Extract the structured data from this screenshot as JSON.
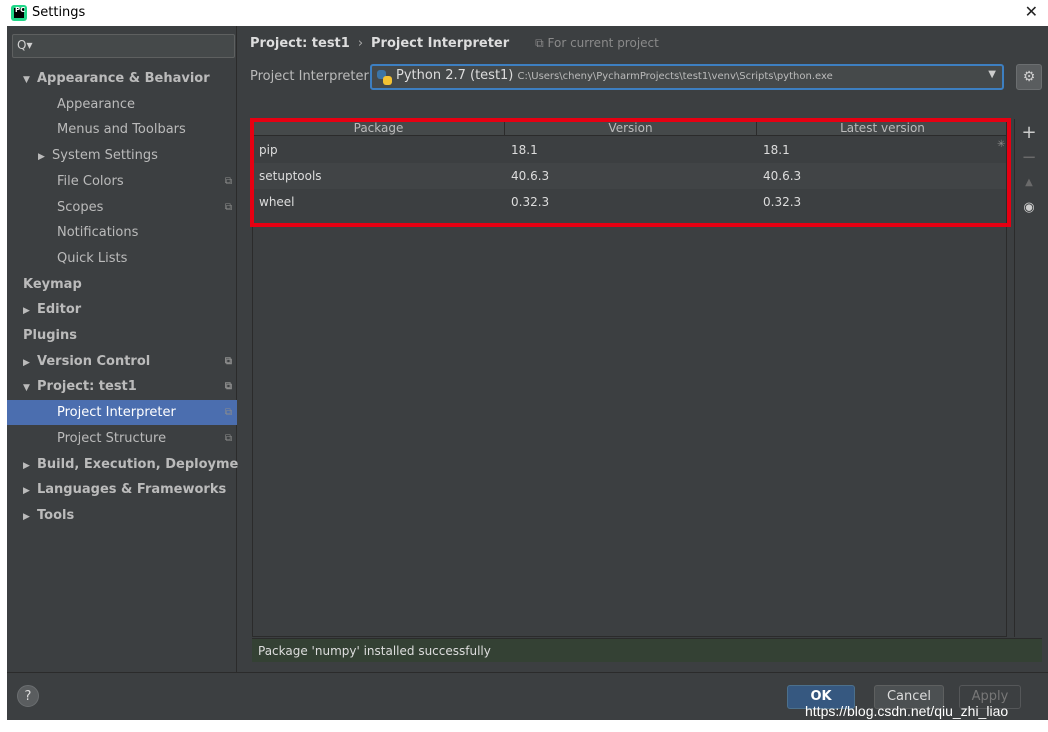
{
  "window": {
    "title": "Settings",
    "close_glyph": "✕"
  },
  "search": {
    "icon": "search-icon",
    "glyph": "Q▾"
  },
  "sidebar": {
    "items": [
      {
        "label": "Appearance & Behavior",
        "arrow": "▼",
        "bold": true
      },
      {
        "label": "Appearance"
      },
      {
        "label": "Menus and Toolbars"
      },
      {
        "label": "System Settings",
        "arrow": "▶"
      },
      {
        "label": "File Colors",
        "copy": true
      },
      {
        "label": "Scopes",
        "copy": true
      },
      {
        "label": "Notifications"
      },
      {
        "label": "Quick Lists"
      },
      {
        "label": "Keymap",
        "bold": true
      },
      {
        "label": "Editor",
        "arrow": "▶",
        "bold": true
      },
      {
        "label": "Plugins",
        "bold": true
      },
      {
        "label": "Version Control",
        "arrow": "▶",
        "bold": true,
        "copy": true
      },
      {
        "label": "Project: test1",
        "arrow": "▼",
        "bold": true,
        "copy": true
      },
      {
        "label": "Project Interpreter",
        "copy": true,
        "selected": true
      },
      {
        "label": "Project Structure",
        "copy": true
      },
      {
        "label": "Build, Execution, Deployment",
        "arrow": "▶",
        "bold": true
      },
      {
        "label": "Languages & Frameworks",
        "arrow": "▶",
        "bold": true
      },
      {
        "label": "Tools",
        "arrow": "▶",
        "bold": true
      }
    ]
  },
  "breadcrumb": {
    "project": "Project: test1",
    "separator": "›",
    "page": "Project Interpreter",
    "scope": "⧉ For current project"
  },
  "interpreter": {
    "label": "Project Interpreter:",
    "name": "Python 2.7 (test1)",
    "path": "C:\\Users\\cheny\\PycharmProjects\\test1\\venv\\Scripts\\python.exe"
  },
  "table": {
    "columns": [
      "Package",
      "Version",
      "Latest version"
    ],
    "rows": [
      [
        "pip",
        "18.1",
        "18.1"
      ],
      [
        "setuptools",
        "40.6.3",
        "40.6.3"
      ],
      [
        "wheel",
        "0.32.3",
        "0.32.3"
      ]
    ]
  },
  "tools": {
    "add": "+",
    "remove": "−",
    "upgrade": "▲",
    "show": "👁"
  },
  "status": {
    "message": "Package 'numpy' installed successfully"
  },
  "footer": {
    "help": "?",
    "ok": "OK",
    "cancel": "Cancel",
    "apply": "Apply"
  },
  "watermark": "https://blog.csdn.net/qiu_zhi_liao",
  "colors": {
    "selection": "#4b6eaf",
    "highlight_box": "#e60012",
    "status_bg": "#344134"
  }
}
